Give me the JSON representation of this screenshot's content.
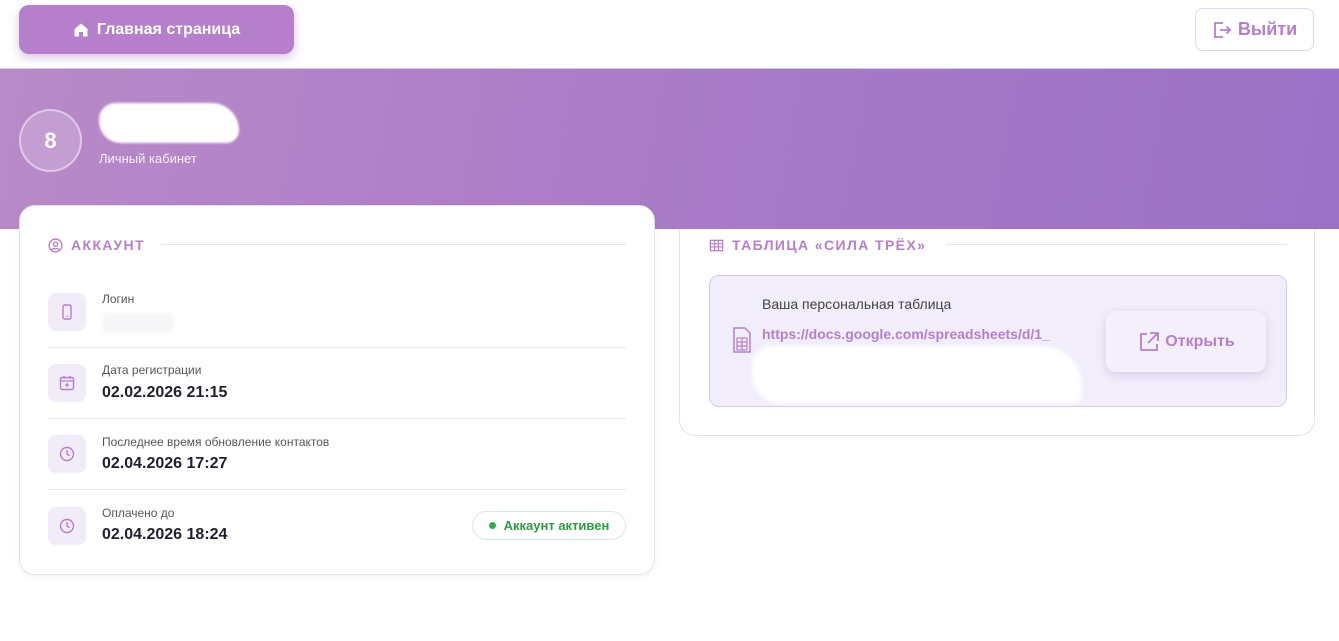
{
  "header": {
    "home_label": "Главная страница",
    "logout_label": "Выйти"
  },
  "profile": {
    "avatar_initial": "8",
    "subtitle": "Личный кабинет"
  },
  "account": {
    "section_title": "АККАУНТ",
    "rows": [
      {
        "label": "Логин",
        "value": ""
      },
      {
        "label": "Дата регистрации",
        "value": "02.02.2026 21:15"
      },
      {
        "label": "Последнее время обновление контактов",
        "value": "02.04.2026 17:27"
      },
      {
        "label": "Оплачено до",
        "value": "02.04.2026 18:24"
      }
    ],
    "status_badge": "Аккаунт активен"
  },
  "table_section": {
    "section_title": "ТАБЛИЦА «СИЛА ТРЁХ»",
    "link_title": "Ваша персональная таблица",
    "link_url": "https://docs.google.com/spreadsheets/d/1_",
    "open_label": "Открыть"
  },
  "colors": {
    "accent": "#b57fcb",
    "hero_start": "#b98ac8",
    "hero_end": "#9b72c6",
    "status_green": "#2e9a45"
  }
}
